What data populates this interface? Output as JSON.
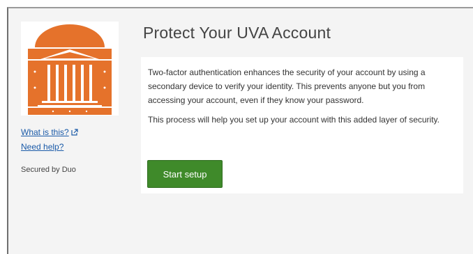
{
  "title": "Protect Your UVA Account",
  "sidebar": {
    "what_is_this": "What is this?",
    "need_help": "Need help?",
    "secured_by": "Secured by Duo"
  },
  "panel": {
    "paragraph1": "Two-factor authentication enhances the security of your account by using a secondary device to verify your identity. This prevents anyone but you from accessing your account, even if they know your password.",
    "paragraph2": "This process will help you set up your account with this added layer of security.",
    "start_label": "Start setup"
  },
  "colors": {
    "brand_orange": "#e5722b",
    "button_green": "#3f8a2a",
    "link_blue": "#1a5aa8"
  }
}
